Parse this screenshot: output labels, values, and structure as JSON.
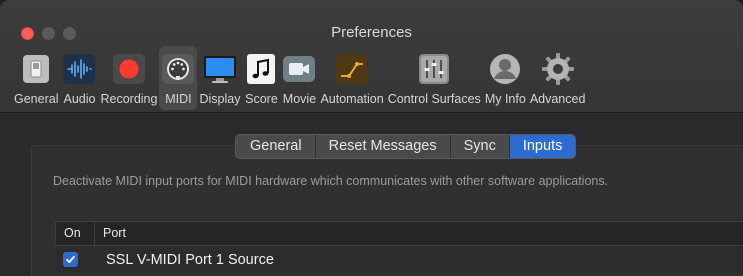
{
  "window": {
    "title": "Preferences"
  },
  "toolbar": {
    "items": [
      {
        "label": "General",
        "icon": "general-switch-icon"
      },
      {
        "label": "Audio",
        "icon": "audio-waveform-icon"
      },
      {
        "label": "Recording",
        "icon": "record-icon"
      },
      {
        "label": "MIDI",
        "icon": "midi-port-icon",
        "selected": true
      },
      {
        "label": "Display",
        "icon": "display-monitor-icon"
      },
      {
        "label": "Score",
        "icon": "music-note-icon"
      },
      {
        "label": "Movie",
        "icon": "video-camera-icon"
      },
      {
        "label": "Automation",
        "icon": "automation-curve-icon"
      },
      {
        "label": "Control Surfaces",
        "icon": "faders-icon"
      },
      {
        "label": "My Info",
        "icon": "user-icon"
      },
      {
        "label": "Advanced",
        "icon": "gear-icon"
      }
    ]
  },
  "tabs": {
    "items": [
      {
        "label": "General"
      },
      {
        "label": "Reset Messages"
      },
      {
        "label": "Sync"
      },
      {
        "label": "Inputs",
        "active": true
      }
    ]
  },
  "inputs": {
    "description": "Deactivate MIDI input ports for MIDI hardware which communicates with other software applications.",
    "columns": {
      "on": "On",
      "port": "Port"
    },
    "rows": [
      {
        "on": true,
        "port": "SSL V-MIDI Port 1 Source"
      }
    ]
  },
  "colors": {
    "accent": "#2d6bd1",
    "close": "#ff5f57",
    "record": "#ff3b30"
  }
}
